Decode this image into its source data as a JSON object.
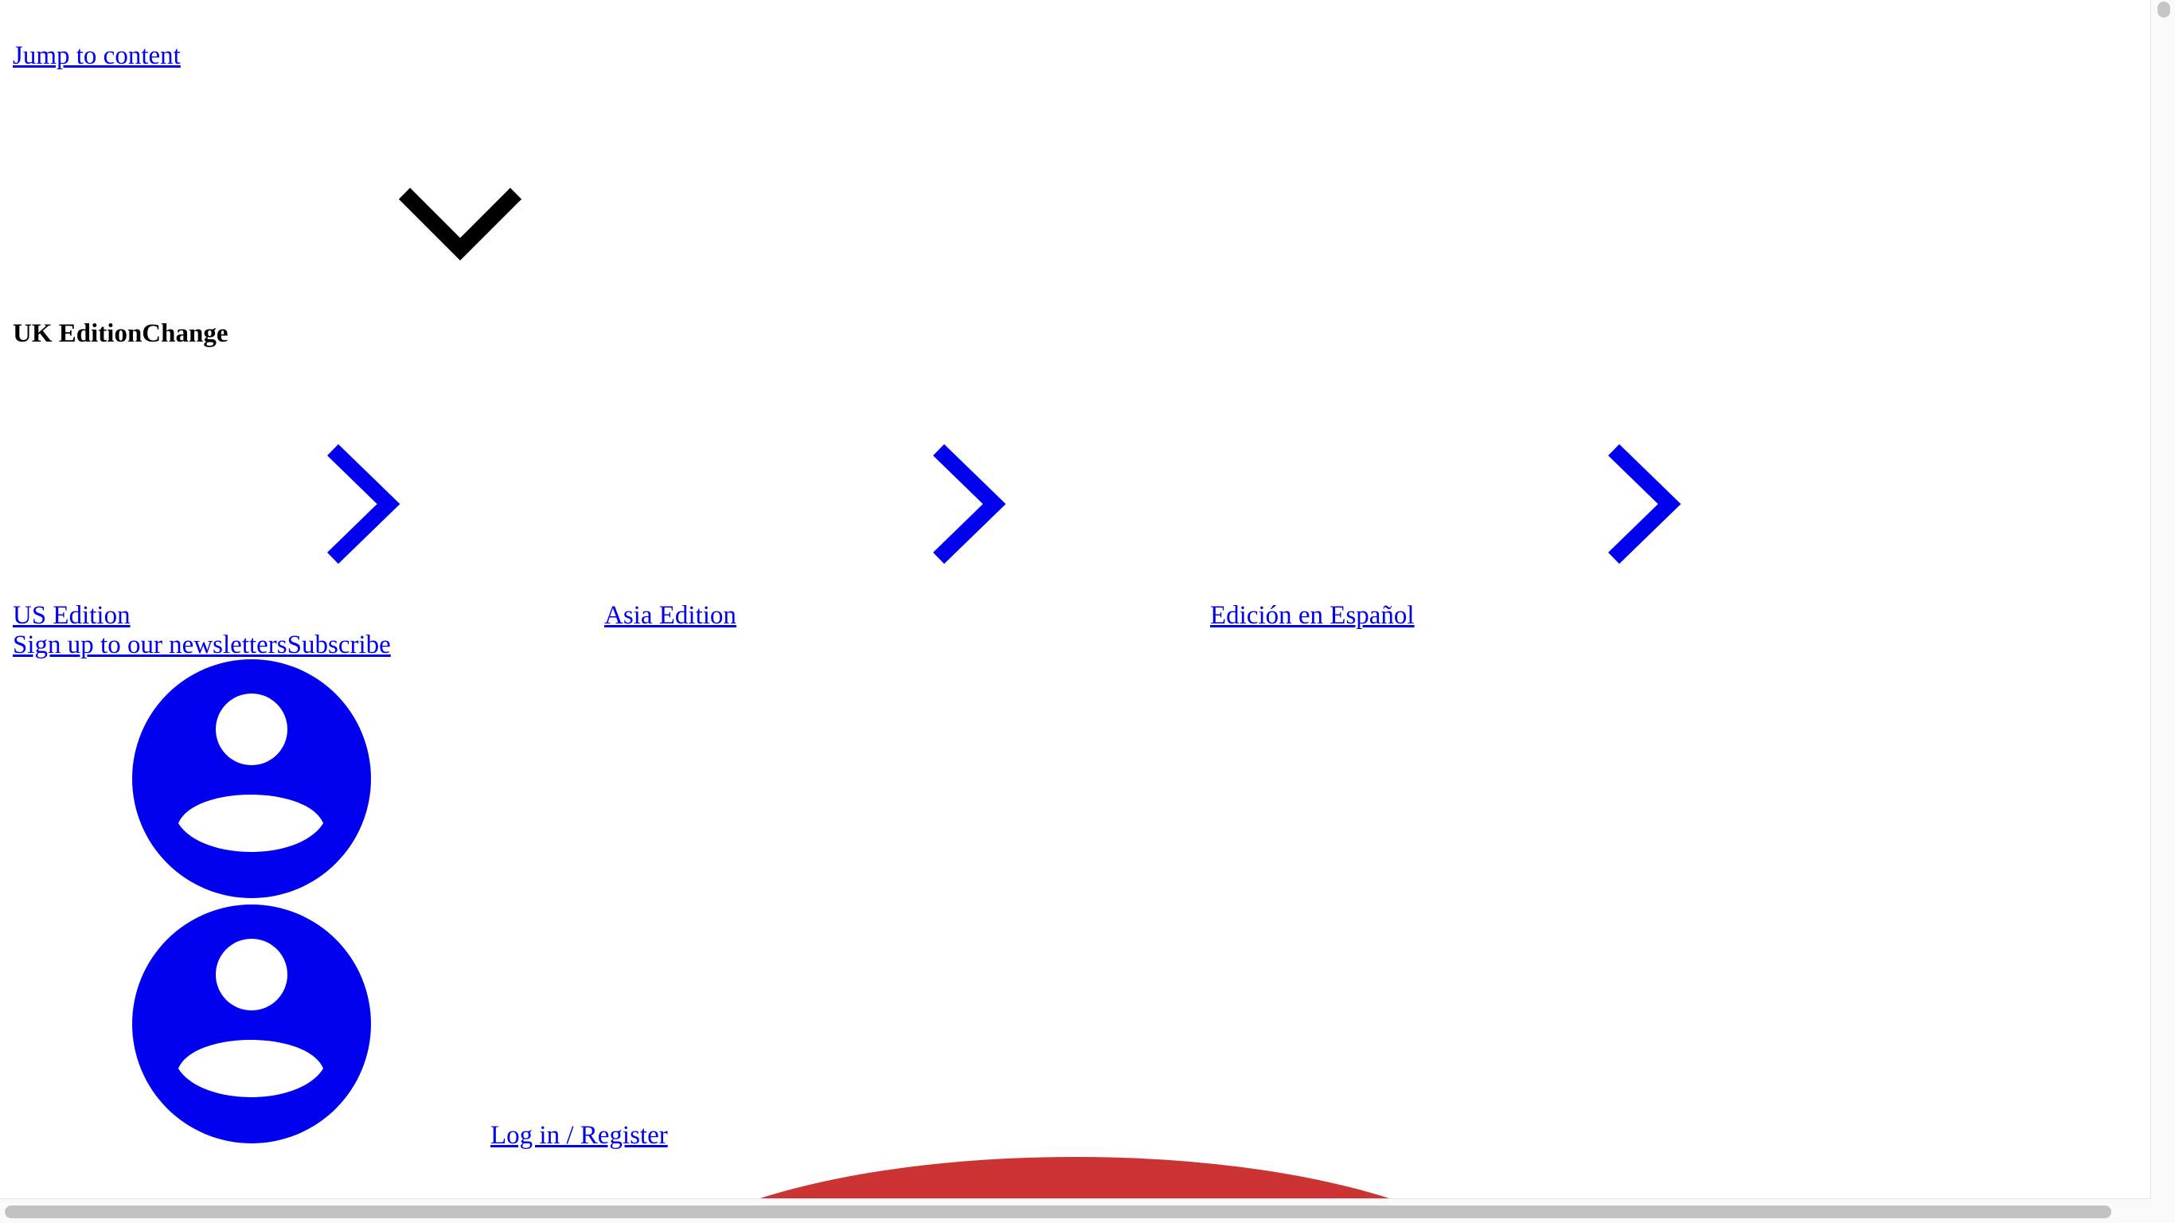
{
  "skip": {
    "label": "Jump to content"
  },
  "edition": {
    "current": "UK Edition",
    "change_label": "Change",
    "options": [
      {
        "label": "US Edition"
      },
      {
        "label": "Asia Edition"
      },
      {
        "label": "Edición en Español"
      }
    ]
  },
  "account": {
    "newsletters_label": "Sign up to our newsletters",
    "subscribe_label": "Subscribe",
    "login_label": "Log in / Register"
  },
  "icons": {
    "toggle": "chevron-down-icon",
    "edition_arrow": "chevron-right-icon",
    "user": "user-icon"
  },
  "colors": {
    "link": "#0000ee",
    "text": "#000000",
    "accent_red": "#cc3333"
  }
}
